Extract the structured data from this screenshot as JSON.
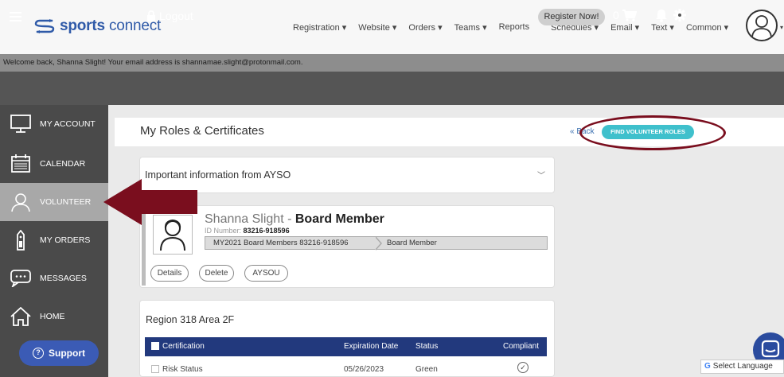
{
  "brand": {
    "bold": "sports",
    "light": " connect"
  },
  "nav": [
    "Registration ▾",
    "Website ▾",
    "Orders ▾",
    "Teams ▾",
    "Reports",
    "Schedules ▾",
    "Email ▾",
    "Text ▾",
    "Common ▾"
  ],
  "welcome": "Welcome back, Shanna Slight! Your email address is shannamae.slight@protonmail.com.",
  "darkbar": {
    "logout": "Logout",
    "register": "Register Now!",
    "cart_count": "0"
  },
  "sidebar": {
    "items": [
      {
        "label": "MY ACCOUNT",
        "icon": "monitor-icon"
      },
      {
        "label": "CALENDAR",
        "icon": "calendar-icon"
      },
      {
        "label": "VOLUNTEER",
        "icon": "person-icon"
      },
      {
        "label": "MY ORDERS",
        "icon": "tag-icon"
      },
      {
        "label": "MESSAGES",
        "icon": "chat-icon"
      },
      {
        "label": "HOME",
        "icon": "home-icon"
      }
    ],
    "support": "Support"
  },
  "page": {
    "title": "My Roles & Certificates",
    "back": "« Back",
    "find_button": "FIND VOLUNTEER ROLES"
  },
  "info": {
    "title": "Important information from AYSO"
  },
  "role": {
    "name": "Shanna Slight - ",
    "role_title": "Board Member",
    "id_label": "ID Number: ",
    "id_value": "83216-918596",
    "breadcrumb1": "MY2021 Board Members 83216-918596",
    "breadcrumb2": "Board Member",
    "buttons": [
      "Details",
      "Delete",
      "AYSOU"
    ]
  },
  "region": {
    "title": "Region 318 Area 2F",
    "columns": [
      "Certification",
      "Expiration Date",
      "Status",
      "Compliant"
    ],
    "rows": [
      {
        "certification": "Risk Status",
        "expiration": "05/26/2023",
        "status": "Green",
        "compliant": "✓"
      }
    ]
  },
  "language": {
    "label": "Select Language"
  },
  "colors": {
    "annotation": "#7a0e1e",
    "accent": "#3fc0cc",
    "table_header": "#22397d"
  }
}
